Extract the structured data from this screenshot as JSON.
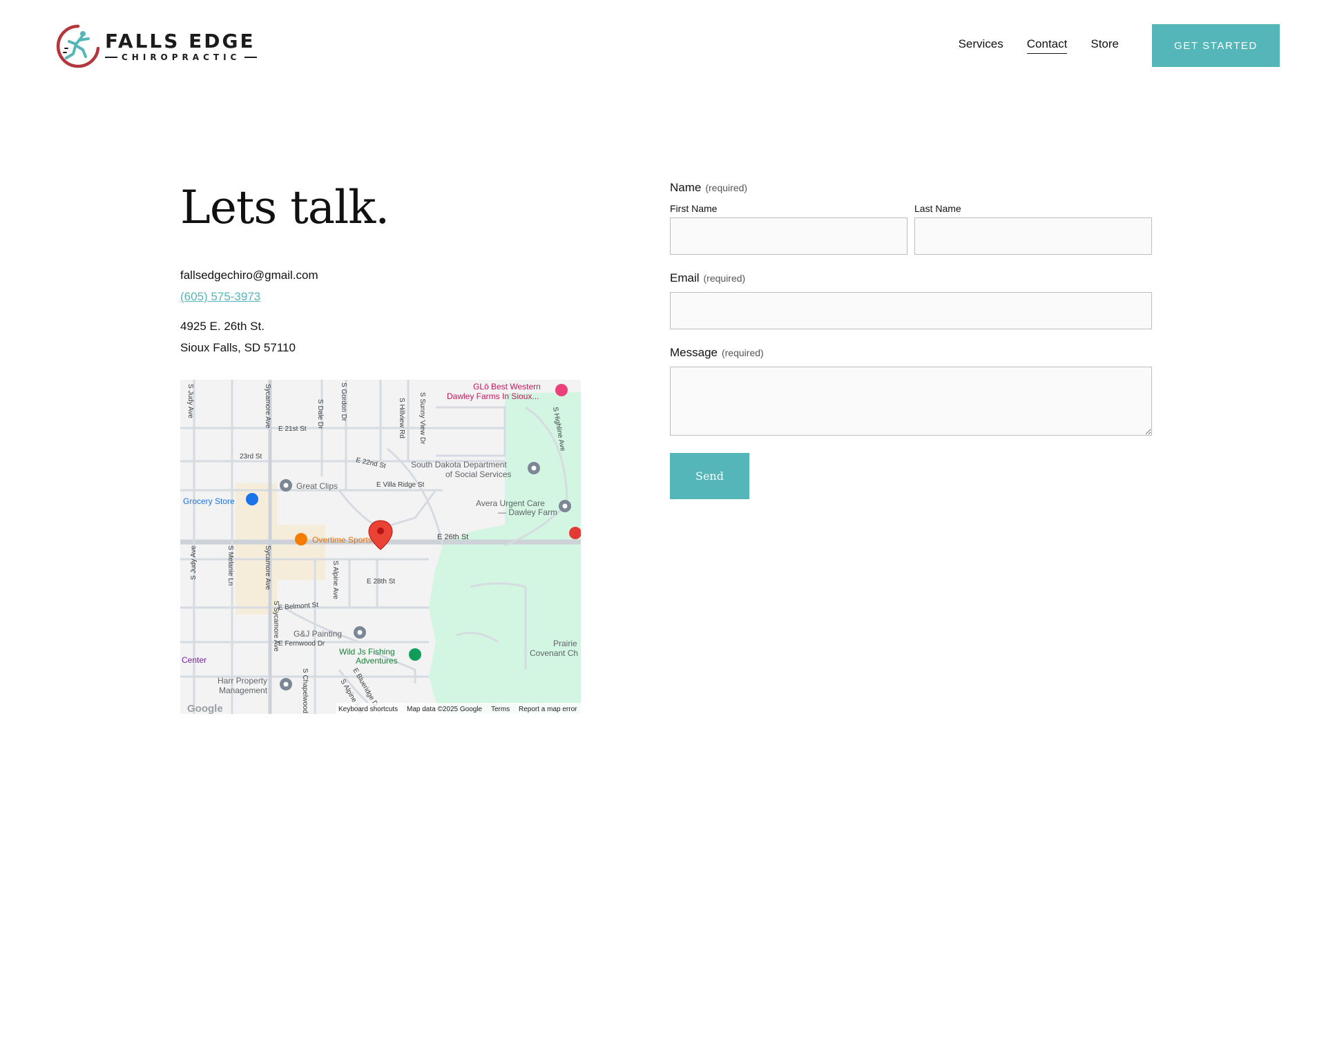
{
  "brand": {
    "name": "FALLS EDGE",
    "tagline": "CHIROPRACTIC",
    "accent_color": "#55b6b9",
    "logo_ring_color": "#b5363a"
  },
  "nav": {
    "items": [
      {
        "label": "Services",
        "active": false
      },
      {
        "label": "Contact",
        "active": true
      },
      {
        "label": "Store",
        "active": false
      }
    ],
    "cta_label": "GET STARTED"
  },
  "contact": {
    "heading": "Lets talk.",
    "email": "fallsedgechiro@gmail.com",
    "phone": "(605) 575-3973",
    "address_line1": "4925 E. 26th St.",
    "address_line2": "Sioux Falls, SD 57110"
  },
  "map": {
    "streets": {
      "e21": "E 21st St",
      "s23": "23rd St",
      "e22": "E 22nd St",
      "villa": "E Villa Ridge St",
      "e26": "E 26th St",
      "e28": "E 28th St",
      "belmont": "E Belmont St",
      "fernwood": "E Fernwood Dr",
      "sycamore": "Sycamore Ave",
      "sycamore2": "S Sycamore Ave",
      "judy": "S Judy Ave",
      "judy2": "S Judy Ave",
      "melanie": "S Melanie Ln",
      "dale": "S Dale Dr",
      "gordon": "S Gordon Dr",
      "hillview": "S Hillview Rd",
      "sunny": "S Sunny View Dr",
      "highline": "S Highline Ave",
      "alpine": "S Alpine Ave",
      "chapelwood": "S Chapelwood",
      "blueridge": "E Blueridge D"
    },
    "places": {
      "glo_line1": "GLō Best Western",
      "glo_line2": "Dawley Farms In Sioux...",
      "sdss_line1": "South Dakota Department",
      "sdss_line2": "of Social Services",
      "avera_line1": "Avera Urgent Care",
      "avera_line2": "— Dawley Farm",
      "great_clips": "Great Clips",
      "grocery": "Grocery Store",
      "overtime": "Overtime Sports Grill",
      "gj": "G&J Painting",
      "wild_line1": "Wild Js Fishing",
      "wild_line2": "Adventures",
      "harr_line1": "Harr Property",
      "harr_line2": "Management",
      "prairie_line1": "Prairie",
      "prairie_line2": "Covenant Ch",
      "center": "Center"
    },
    "footer": {
      "shortcuts": "Keyboard shortcuts",
      "data": "Map data ©2025 Google",
      "terms": "Terms",
      "report": "Report a map error",
      "google": "Google"
    }
  },
  "form": {
    "name_label": "Name",
    "required_text": "(required)",
    "first_name_label": "First Name",
    "last_name_label": "Last Name",
    "first_name_value": "",
    "last_name_value": "",
    "email_label": "Email",
    "email_value": "",
    "message_label": "Message",
    "message_value": "",
    "send_label": "Send"
  }
}
